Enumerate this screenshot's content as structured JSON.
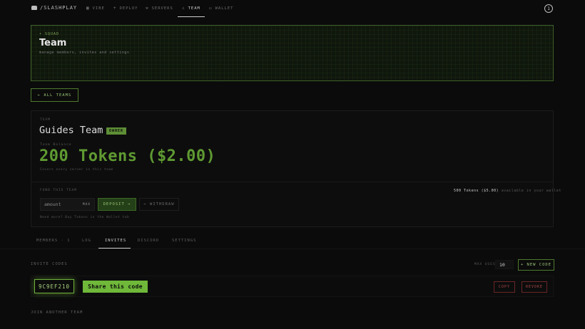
{
  "nav": {
    "brand": "/SLASHPLAY",
    "items": [
      {
        "label": "VIBE",
        "icon": "grid-icon"
      },
      {
        "label": "DEPLOY",
        "icon": "plus-icon"
      },
      {
        "label": "SERVERS",
        "icon": "tools-icon"
      },
      {
        "label": "TEAM",
        "icon": "user-icon",
        "active": true
      },
      {
        "label": "WALLET",
        "icon": "wallet-icon"
      }
    ],
    "avatar": "1"
  },
  "header": {
    "eyebrow": "• SQUAD",
    "title": "Team",
    "subtitle": "manage members, invites and settings"
  },
  "back_button": "← ALL TEAMS",
  "team": {
    "label": "TEAM",
    "name": "Guides Team",
    "role_badge": "OWNER",
    "balance_label": "Team Balance",
    "balance": "200 Tokens ($2.00)",
    "balance_note": "Covers every server in this team",
    "fund_label": "FUND THIS TEAM",
    "wallet_available": "500 Tokens ($5.00)",
    "wallet_suffix": "available in your wallet",
    "amount_placeholder": "amount",
    "max_label": "MAX",
    "deposit_label": "DEPOSIT →",
    "withdraw_label": "← WITHDRAW",
    "fund_note": "Need more? Buy Tokens in the Wallet tab"
  },
  "tabs": [
    {
      "label": "MEMBERS · 1"
    },
    {
      "label": "LOG"
    },
    {
      "label": "INVITES",
      "active": true
    },
    {
      "label": "DISCORD"
    },
    {
      "label": "SETTINGS"
    }
  ],
  "invites": {
    "title": "INVITE CODES",
    "max_uses_label": "MAX USES",
    "max_uses_value": "10",
    "new_code_label": "+ NEW CODE",
    "code": "9C9EF210",
    "share_label": "Share this code",
    "copy_label": "COPY",
    "revoke_label": "REVOKE"
  },
  "join": {
    "title": "JOIN ANOTHER TEAM"
  },
  "colors": {
    "accent": "#6fb83a",
    "danger": "#b04a4a",
    "background": "#0b0b0b"
  }
}
